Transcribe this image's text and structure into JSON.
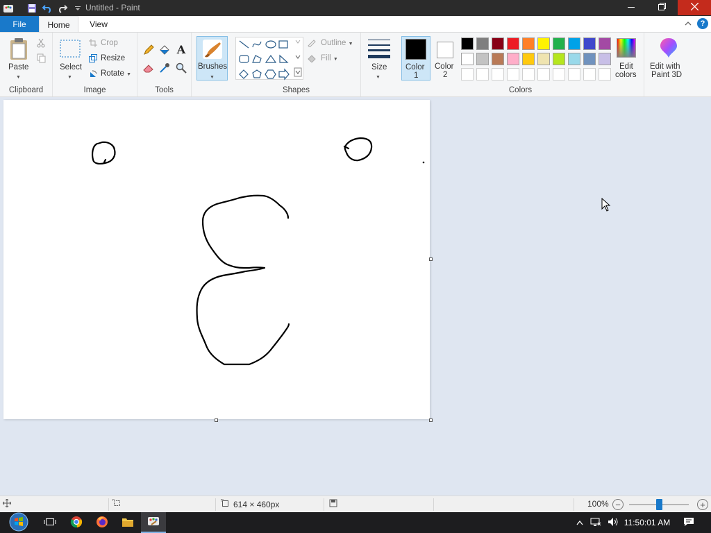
{
  "window": {
    "title": "Untitled - Paint",
    "minimize_icon": "minimize-icon",
    "restore_icon": "restore-icon",
    "close_icon": "close-icon"
  },
  "ribbon_tabs": {
    "file": "File",
    "home": "Home",
    "view": "View"
  },
  "clipboard": {
    "paste": "Paste",
    "group": "Clipboard"
  },
  "image": {
    "select": "Select",
    "crop": "Crop",
    "resize": "Resize",
    "rotate": "Rotate",
    "group": "Image"
  },
  "tools": {
    "group": "Tools"
  },
  "brushes": {
    "label": "Brushes"
  },
  "shapes": {
    "outline": "Outline",
    "fill": "Fill",
    "group": "Shapes"
  },
  "size": {
    "label": "Size"
  },
  "colors": {
    "color1_line1": "Color",
    "color1_line2": "1",
    "color2_line1": "Color",
    "color2_line2": "2",
    "color1_value": "#000000",
    "color2_value": "#ffffff",
    "edit_colors_line1": "Edit",
    "edit_colors_line2": "colors",
    "paint3d_line1": "Edit with",
    "paint3d_line2": "Paint 3D",
    "group": "Colors",
    "palette_row1": [
      "#000000",
      "#7f7f7f",
      "#880015",
      "#ed1c24",
      "#ff7f27",
      "#fff200",
      "#22b14c",
      "#00a2e8",
      "#3f48cc",
      "#a349a4"
    ],
    "palette_row2": [
      "#ffffff",
      "#c3c3c3",
      "#b97a57",
      "#ffaec9",
      "#ffc90e",
      "#efe4b0",
      "#b5e61d",
      "#99d9ea",
      "#7092be",
      "#c8bfe7"
    ]
  },
  "statusbar": {
    "canvas_size": "614 × 460px",
    "zoom": "100%",
    "zoom_level": 0.5
  },
  "taskbar": {
    "time": "11:50:01 AM"
  }
}
